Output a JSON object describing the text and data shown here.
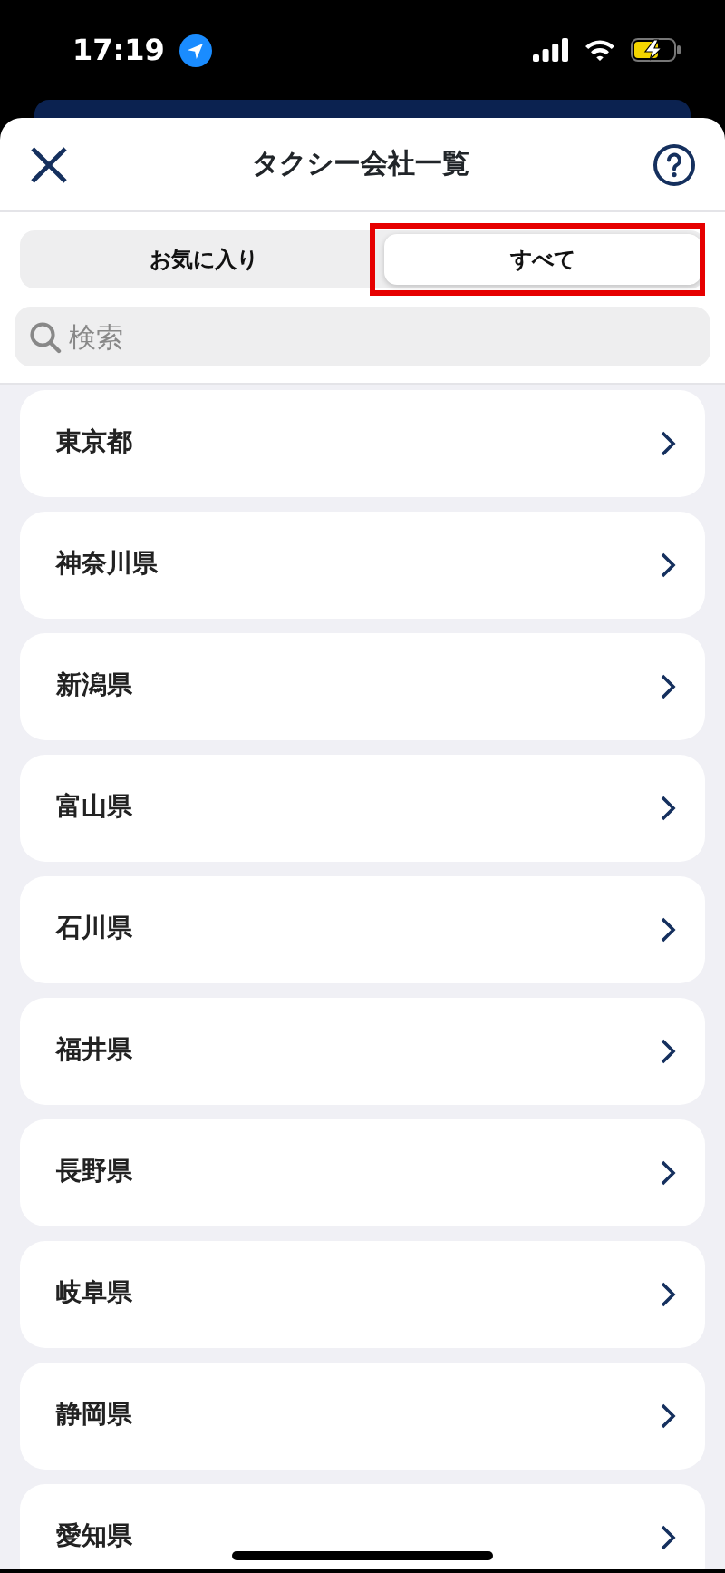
{
  "status_bar": {
    "time": "17:19"
  },
  "header": {
    "title": "タクシー会社一覧"
  },
  "tabs": [
    {
      "label": "お気に入り",
      "selected": false,
      "highlighted": false
    },
    {
      "label": "すべて",
      "selected": true,
      "highlighted": true
    }
  ],
  "search": {
    "placeholder": "検索"
  },
  "prefectures": [
    {
      "name": "東京都"
    },
    {
      "name": "神奈川県"
    },
    {
      "name": "新潟県"
    },
    {
      "name": "富山県"
    },
    {
      "name": "石川県"
    },
    {
      "name": "福井県"
    },
    {
      "name": "長野県"
    },
    {
      "name": "岐阜県"
    },
    {
      "name": "静岡県"
    },
    {
      "name": "愛知県"
    }
  ]
}
